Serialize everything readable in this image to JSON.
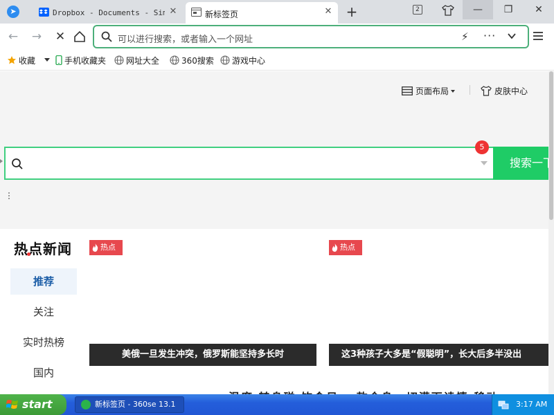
{
  "browser": {
    "tabs": [
      {
        "title": "Dropbox - Documents - Simpl",
        "close": "✕"
      },
      {
        "title": "新标签页",
        "close": "✕"
      }
    ],
    "new_tab": "+",
    "tab_count": "2",
    "window_controls": {
      "minimize": "—",
      "restore": "❐",
      "close": "✕"
    },
    "address_placeholder": "可以进行搜索，或者输入一个网址",
    "more_dots": "···"
  },
  "bookmarks": [
    {
      "label": "收藏"
    },
    {
      "label": "手机收藏夹"
    },
    {
      "label": "网址大全"
    },
    {
      "label": "360搜索"
    },
    {
      "label": "游戏中心"
    }
  ],
  "toolbar": {
    "layout_label": "页面布局",
    "skin_label": "皮肤中心"
  },
  "search": {
    "button_label": "搜索一下",
    "badge_count": "5"
  },
  "news": {
    "section_title": "热点新闻",
    "nav": [
      {
        "label": "推荐",
        "active": true
      },
      {
        "label": "关注",
        "active": false
      },
      {
        "label": "实时热榜",
        "active": false
      },
      {
        "label": "国内",
        "active": false
      }
    ],
    "cards": [
      {
        "tag": "热点",
        "caption": "美俄一旦发生冲突，俄罗斯能坚持多长时"
      },
      {
        "tag": "热点",
        "caption": "这3种孩子大多是“假聪明”，长大后多半没出"
      }
    ],
    "headline_partial": "温度 转身碰 饮食日一 款会身一切满面读情 移动"
  },
  "taskbar": {
    "start_label": "start",
    "task_item": "新标签页 - 360se 13.1",
    "clock": "3:17 AM"
  },
  "colors": {
    "accent_green": "#1fcc66",
    "hot_red": "#e7484e",
    "taskbar_blue": "#245edb"
  }
}
